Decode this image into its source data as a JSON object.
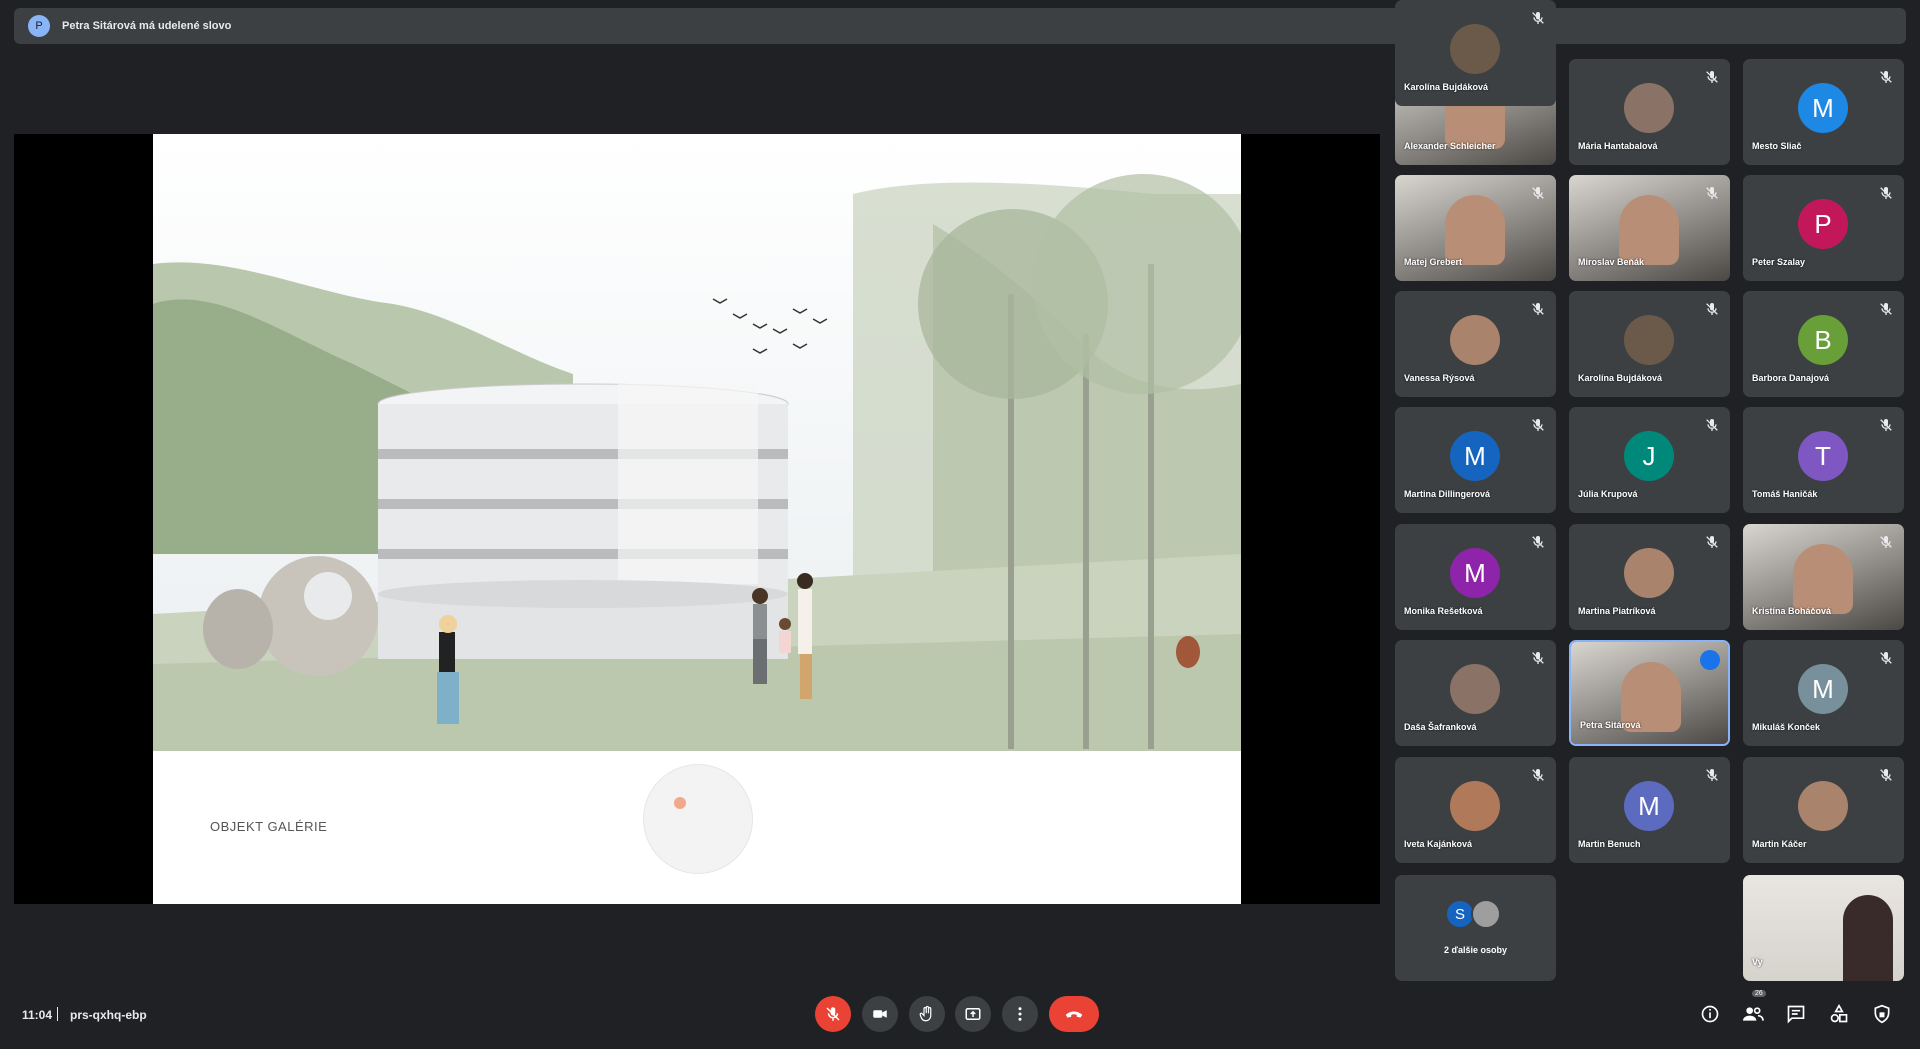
{
  "banner": {
    "avatar_letter": "P",
    "text": "Petra Sitárová má udelené slovo"
  },
  "slide": {
    "caption": "OBJEKT GALÉRIE"
  },
  "participants": [
    {
      "name": "Alexander Schleicher",
      "type": "video",
      "muted": true
    },
    {
      "name": "Mária Hantabalová",
      "type": "photo",
      "muted": true
    },
    {
      "name": "Mesto Sliač",
      "type": "letter",
      "letter": "M",
      "color": "#1e88e5",
      "muted": true
    },
    {
      "name": "Matej Grebert",
      "type": "video",
      "muted": true
    },
    {
      "name": "Miroslav Beňák",
      "type": "video",
      "muted": true
    },
    {
      "name": "Peter Szalay",
      "type": "letter",
      "letter": "P",
      "color": "#c2185b",
      "muted": true
    },
    {
      "name": "Vanessa Rýsová",
      "type": "photo",
      "muted": true
    },
    {
      "name": "Karolína Bujdáková",
      "type": "photo",
      "muted": true
    },
    {
      "name": "Barbora Danajová",
      "type": "letter",
      "letter": "B",
      "color": "#689f38",
      "muted": true
    },
    {
      "name": "Martina Dillingerová",
      "type": "letter",
      "letter": "M",
      "color": "#1565c0",
      "muted": true
    },
    {
      "name": "Júlia Krupová",
      "type": "letter",
      "letter": "J",
      "color": "#00897b",
      "muted": true
    },
    {
      "name": "Tomáš Haničák",
      "type": "letter",
      "letter": "T",
      "color": "#7e57c2",
      "muted": true
    },
    {
      "name": "Monika Rešetková",
      "type": "letter",
      "letter": "M",
      "color": "#8e24aa",
      "muted": true
    },
    {
      "name": "Martina Piatríková",
      "type": "photo",
      "muted": true
    },
    {
      "name": "Kristína Boháčová",
      "type": "video",
      "muted": true
    },
    {
      "name": "Daša Šafranková",
      "type": "photo",
      "muted": true
    },
    {
      "name": "Petra Sitárová",
      "type": "video",
      "muted": false,
      "speaking": true
    },
    {
      "name": "Mikuláš Konček",
      "type": "letter",
      "letter": "M",
      "color": "#78909c",
      "muted": true
    },
    {
      "name": "Iveta Kajánková",
      "type": "photo",
      "muted": true
    },
    {
      "name": "Martin Benuch",
      "type": "letter",
      "letter": "M",
      "color": "#5c6bc0",
      "muted": true
    },
    {
      "name": "Martin Káčer",
      "type": "photo",
      "muted": true
    },
    {
      "name": "Karolína Bujdáková",
      "type": "photo",
      "muted": true
    }
  ],
  "more": {
    "letter": "S",
    "color": "#1565c0",
    "label": "2 ďalšie osoby"
  },
  "self_tile": {
    "name": "Vy"
  },
  "bottom": {
    "time": "11:04",
    "meeting_code": "prs-qxhq-ebp",
    "participant_count": "26"
  },
  "colors": {
    "background": "#202124",
    "surface": "#3c4043",
    "danger": "#ea4335",
    "accent": "#8ab4f8"
  },
  "icons": [
    "mic-off-icon",
    "camera-icon",
    "raise-hand-icon",
    "present-icon",
    "more-options-icon",
    "hang-up-icon",
    "info-icon",
    "people-icon",
    "chat-icon",
    "activities-icon",
    "host-controls-icon"
  ]
}
